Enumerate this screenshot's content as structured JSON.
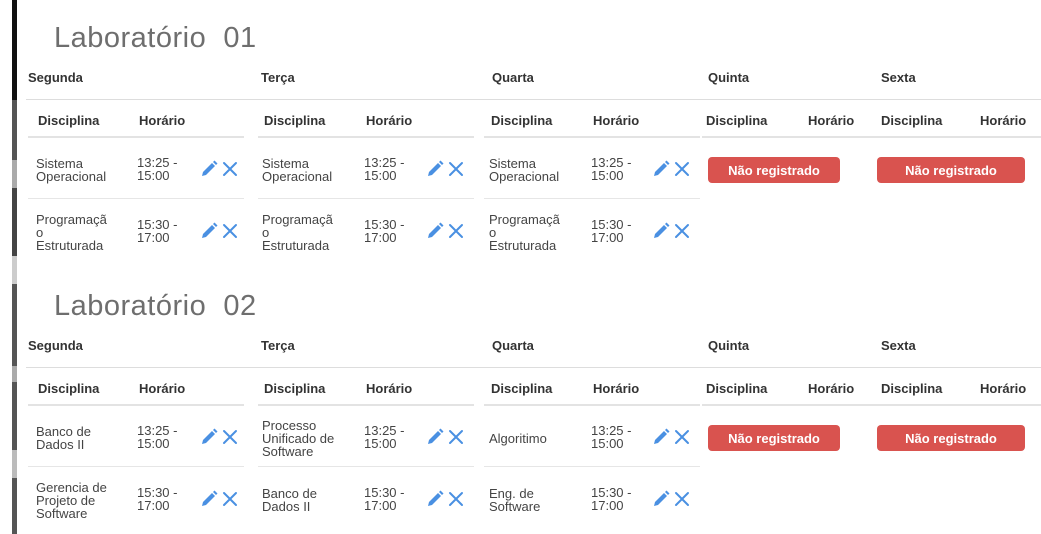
{
  "labs": [
    {
      "title": "Laboratório  01",
      "days": [
        "Segunda",
        "Terça",
        "Quarta",
        "Quinta",
        "Sexta"
      ],
      "col_headers": {
        "discipline": "Disciplina",
        "time": "Horário"
      },
      "rows": [
        {
          "segunda": {
            "discipline": [
              "Sistema",
              "Operacional"
            ],
            "time": [
              "13:25 -",
              "15:00"
            ]
          },
          "terca": {
            "discipline": [
              "Sistema",
              "Operacional"
            ],
            "time": [
              "13:25 -",
              "15:00"
            ]
          },
          "quarta": {
            "discipline": [
              "Sistema",
              "Operacional"
            ],
            "time": [
              "13:25 -",
              "15:00"
            ]
          }
        },
        {
          "segunda": {
            "discipline": [
              "Programaçã",
              "o",
              "Estruturada"
            ],
            "time": [
              "15:30 -",
              "17:00"
            ]
          },
          "terca": {
            "discipline": [
              "Programaçã",
              "o",
              "Estruturada"
            ],
            "time": [
              "15:30 -",
              "17:00"
            ]
          },
          "quarta": {
            "discipline": [
              "Programaçã",
              "o",
              "Estruturada"
            ],
            "time": [
              "15:30 -",
              "17:00"
            ]
          }
        }
      ],
      "quinta_status": "Não registrado",
      "sexta_status": "Não registrado"
    },
    {
      "title": "Laboratório  02",
      "days": [
        "Segunda",
        "Terça",
        "Quarta",
        "Quinta",
        "Sexta"
      ],
      "col_headers": {
        "discipline": "Disciplina",
        "time": "Horário"
      },
      "rows": [
        {
          "segunda": {
            "discipline": [
              "Banco de",
              "Dados II"
            ],
            "time": [
              "13:25 -",
              "15:00"
            ]
          },
          "terca": {
            "discipline": [
              "Processo",
              "Unificado de",
              "Software"
            ],
            "time": [
              "13:25 -",
              "15:00"
            ]
          },
          "quarta": {
            "discipline": [
              "Algoritimo"
            ],
            "time": [
              "13:25 -",
              "15:00"
            ]
          }
        },
        {
          "segunda": {
            "discipline": [
              "Gerencia de",
              "Projeto de",
              "Software"
            ],
            "time": [
              "15:30 -",
              "17:00"
            ]
          },
          "terca": {
            "discipline": [
              "Banco de",
              "Dados II"
            ],
            "time": [
              "15:30 -",
              "17:00"
            ]
          },
          "quarta": {
            "discipline": [
              "Eng. de",
              "Software"
            ],
            "time": [
              "15:30 -",
              "17:00"
            ]
          }
        }
      ],
      "quinta_status": "Não registrado",
      "sexta_status": "Não registrado"
    }
  ],
  "icons": {
    "edit": "pencil-icon",
    "delete": "close-icon"
  },
  "colors": {
    "accent": "#4a90e2",
    "danger": "#d9534f",
    "title": "#6e6e6e",
    "edge": "#111111"
  }
}
